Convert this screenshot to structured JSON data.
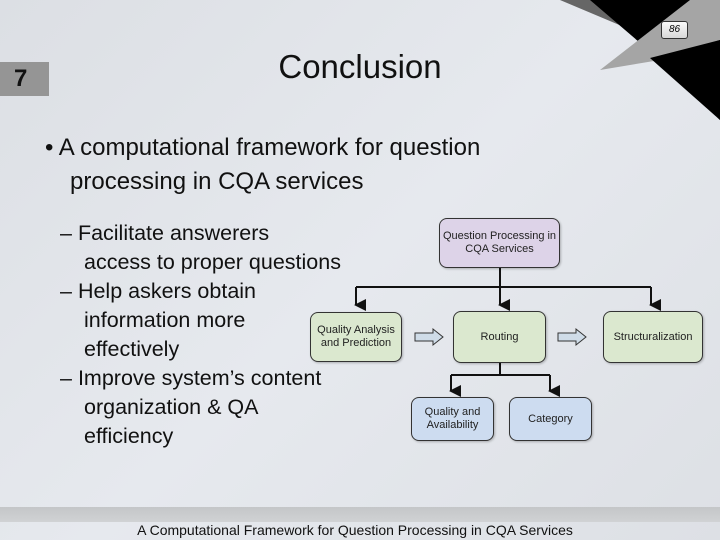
{
  "slide": {
    "section_number": "7",
    "page_number": "86",
    "title": "Conclusion",
    "bullet": "A computational framework for question processing in CQA services",
    "bullet_lines": [
      "A computational framework for question",
      "processing in CQA services"
    ],
    "sub_bullets": [
      {
        "lines": [
          "Facilitate answerers",
          "access to proper questions"
        ]
      },
      {
        "lines": [
          "Help askers obtain",
          "information more",
          "effectively"
        ]
      },
      {
        "lines": [
          "Improve system’s content",
          "organization & QA",
          "efficiency"
        ]
      }
    ],
    "footer": "A Computational Framework for Question Processing in CQA Services"
  },
  "diagram": {
    "root": "Question Processing in CQA Services",
    "quality": "Quality Analysis and Prediction",
    "routing": "Routing",
    "structuralization": "Structuralization",
    "availability": "Quality and Availability",
    "category": "Category",
    "colors": {
      "root": "#ddd3e8",
      "green": "#dbe8cf",
      "blue": "#cddcf0"
    }
  }
}
